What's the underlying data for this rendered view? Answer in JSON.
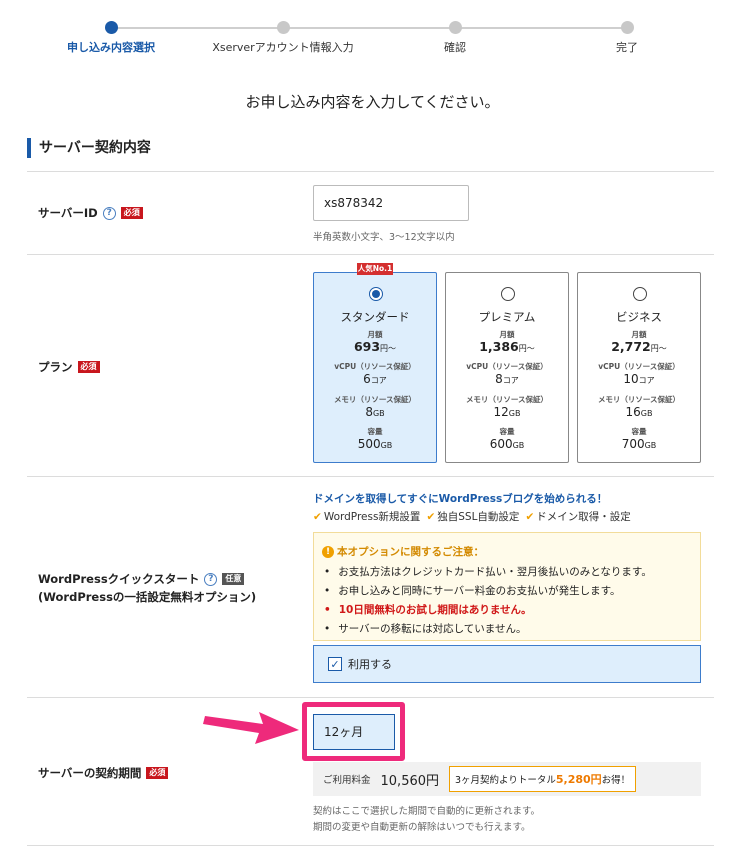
{
  "stepper": {
    "steps": [
      {
        "label": "申し込み内容選択",
        "active": true
      },
      {
        "label": "Xserverアカウント情報入力",
        "active": false
      },
      {
        "label": "確認",
        "active": false
      },
      {
        "label": "完了",
        "active": false
      }
    ]
  },
  "heading": "お申し込み内容を入力してください。",
  "section_title": "サーバー契約内容",
  "server_id": {
    "label": "サーバーID",
    "required": "必須",
    "value": "xs878342",
    "hint": "半角英数小文字、3〜12文字以内"
  },
  "plan": {
    "label": "プラン",
    "required": "必須",
    "ribbon": "人気No.1",
    "cards": [
      {
        "name": "スタンダード",
        "price_label": "月額",
        "price": "693",
        "price_unit": "円〜",
        "cpu_label": "vCPU（リソース保証）",
        "cpu": "6",
        "cpu_unit": "コア",
        "mem_label": "メモリ（リソース保証）",
        "mem": "8",
        "mem_unit": "GB",
        "storage_label": "容量",
        "storage": "500",
        "storage_unit": "GB",
        "selected": true
      },
      {
        "name": "プレミアム",
        "price_label": "月額",
        "price": "1,386",
        "price_unit": "円〜",
        "cpu_label": "vCPU（リソース保証）",
        "cpu": "8",
        "cpu_unit": "コア",
        "mem_label": "メモリ（リソース保証）",
        "mem": "12",
        "mem_unit": "GB",
        "storage_label": "容量",
        "storage": "600",
        "storage_unit": "GB",
        "selected": false
      },
      {
        "name": "ビジネス",
        "price_label": "月額",
        "price": "2,772",
        "price_unit": "円〜",
        "cpu_label": "vCPU（リソース保証）",
        "cpu": "10",
        "cpu_unit": "コア",
        "mem_label": "メモリ（リソース保証）",
        "mem": "16",
        "mem_unit": "GB",
        "storage_label": "容量",
        "storage": "700",
        "storage_unit": "GB",
        "selected": false
      }
    ]
  },
  "wp_quick": {
    "label_line1": "WordPressクイックスタート",
    "optional": "任意",
    "label_line2": "(WordPressの一括設定無料オプション)",
    "promo": "ドメインを取得してすぐにWordPressブログを始められる！",
    "features": [
      "WordPress新規設置",
      "独自SSL自動設定",
      "ドメイン取得・設定"
    ],
    "notice_title": "本オプションに関するご注意：",
    "notice_items": [
      "お支払方法はクレジットカード払い・翌月後払いのみとなります。",
      "お申し込みと同時にサーバー料金のお支払いが発生します。",
      "10日間無料のお試し期間はありません。",
      "サーバーの移転には対応していません。"
    ],
    "use_label": "利用する",
    "use_checked": true
  },
  "contract": {
    "label": "サーバーの契約期間",
    "required": "必須",
    "period": "12ヶ月",
    "price_label": "ご利用料金",
    "price": "10,560円",
    "badge_prefix": "3ヶ月契約よりトータル",
    "badge_amount": "5,280円",
    "badge_suffix": "お得！",
    "note1": "契約はここで選択した期間で自動的に更新されます。",
    "note2": "期間の変更や自動更新の解除はいつでも行えます。"
  },
  "colors": {
    "primary": "#1a5aa8",
    "required_badge": "#c8161d",
    "highlight": "#ee2a7b",
    "selected_bg": "#deeefc"
  }
}
